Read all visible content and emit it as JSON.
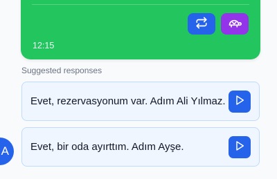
{
  "message": {
    "timestamp": "12:15",
    "actions": [
      {
        "icon": "repeat-icon",
        "color": "#2563eb"
      },
      {
        "icon": "turtle-icon",
        "color": "#9333ea"
      }
    ]
  },
  "suggestions": {
    "label": "Suggested responses",
    "items": [
      {
        "text": "Evet, rezervasyonum var. Adım Ali Yılmaz.",
        "icon": "play-icon"
      },
      {
        "text": "Evet, bir oda ayırttım. Adım Ayşe.",
        "icon": "play-icon"
      }
    ]
  },
  "avatar": {
    "initial": "A"
  },
  "colors": {
    "bubble": "#22c55e",
    "accent": "#2563eb",
    "purple": "#9333ea",
    "card_bg": "#eff6ff",
    "card_border": "#bfdbfe"
  }
}
